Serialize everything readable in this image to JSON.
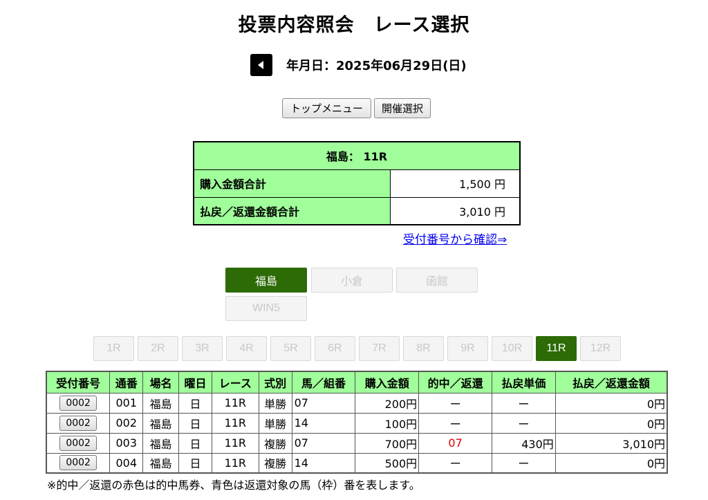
{
  "page": {
    "title": "投票内容照会　レース選択"
  },
  "date": {
    "label": "年月日：2025年06月29日(日)"
  },
  "nav_buttons": {
    "top_menu": "トップメニュー",
    "venue_select": "開催選択"
  },
  "summary": {
    "header": "福島： 11R",
    "purchase_label": "購入金額合計",
    "purchase_value": "1,500 円",
    "refund_label": "払戻／返還金額合計",
    "refund_value": "3,010 円"
  },
  "confirm_link": "受付番号から確認⇒",
  "venues": [
    {
      "label": "福島",
      "active": true
    },
    {
      "label": "小倉",
      "active": false
    },
    {
      "label": "函館",
      "active": false
    },
    {
      "label": "WIN5",
      "active": false
    }
  ],
  "races": [
    "1R",
    "2R",
    "3R",
    "4R",
    "5R",
    "6R",
    "7R",
    "8R",
    "9R",
    "10R",
    "11R",
    "12R"
  ],
  "active_race": "11R",
  "table": {
    "headers": [
      "受付番号",
      "通番",
      "場名",
      "曜日",
      "レース",
      "式別",
      "馬／組番",
      "購入金額",
      "的中／返還",
      "払戻単価",
      "払戻／返還金額"
    ],
    "rows": [
      {
        "receipt": "0002",
        "seq": "001",
        "venue": "福島",
        "day": "日",
        "race": "11R",
        "type": "単勝",
        "horse": "07",
        "amount": "200円",
        "hit": "ー",
        "unit": "ー",
        "payout": "0円"
      },
      {
        "receipt": "0002",
        "seq": "002",
        "venue": "福島",
        "day": "日",
        "race": "11R",
        "type": "単勝",
        "horse": "14",
        "amount": "100円",
        "hit": "ー",
        "unit": "ー",
        "payout": "0円"
      },
      {
        "receipt": "0002",
        "seq": "003",
        "venue": "福島",
        "day": "日",
        "race": "11R",
        "type": "複勝",
        "horse": "07",
        "amount": "700円",
        "hit": "07",
        "unit": "430円",
        "payout": "3,010円"
      },
      {
        "receipt": "0002",
        "seq": "004",
        "venue": "福島",
        "day": "日",
        "race": "11R",
        "type": "複勝",
        "horse": "14",
        "amount": "500円",
        "hit": "ー",
        "unit": "ー",
        "payout": "0円"
      }
    ]
  },
  "note": "※的中／返還の赤色は的中馬券、青色は返還対象の馬（枠）番を表します。",
  "colors": {
    "header_green": "#a0ff9a",
    "active_green": "#2c6b06",
    "hit_red": "#e00000",
    "link_blue": "#0000ee"
  }
}
